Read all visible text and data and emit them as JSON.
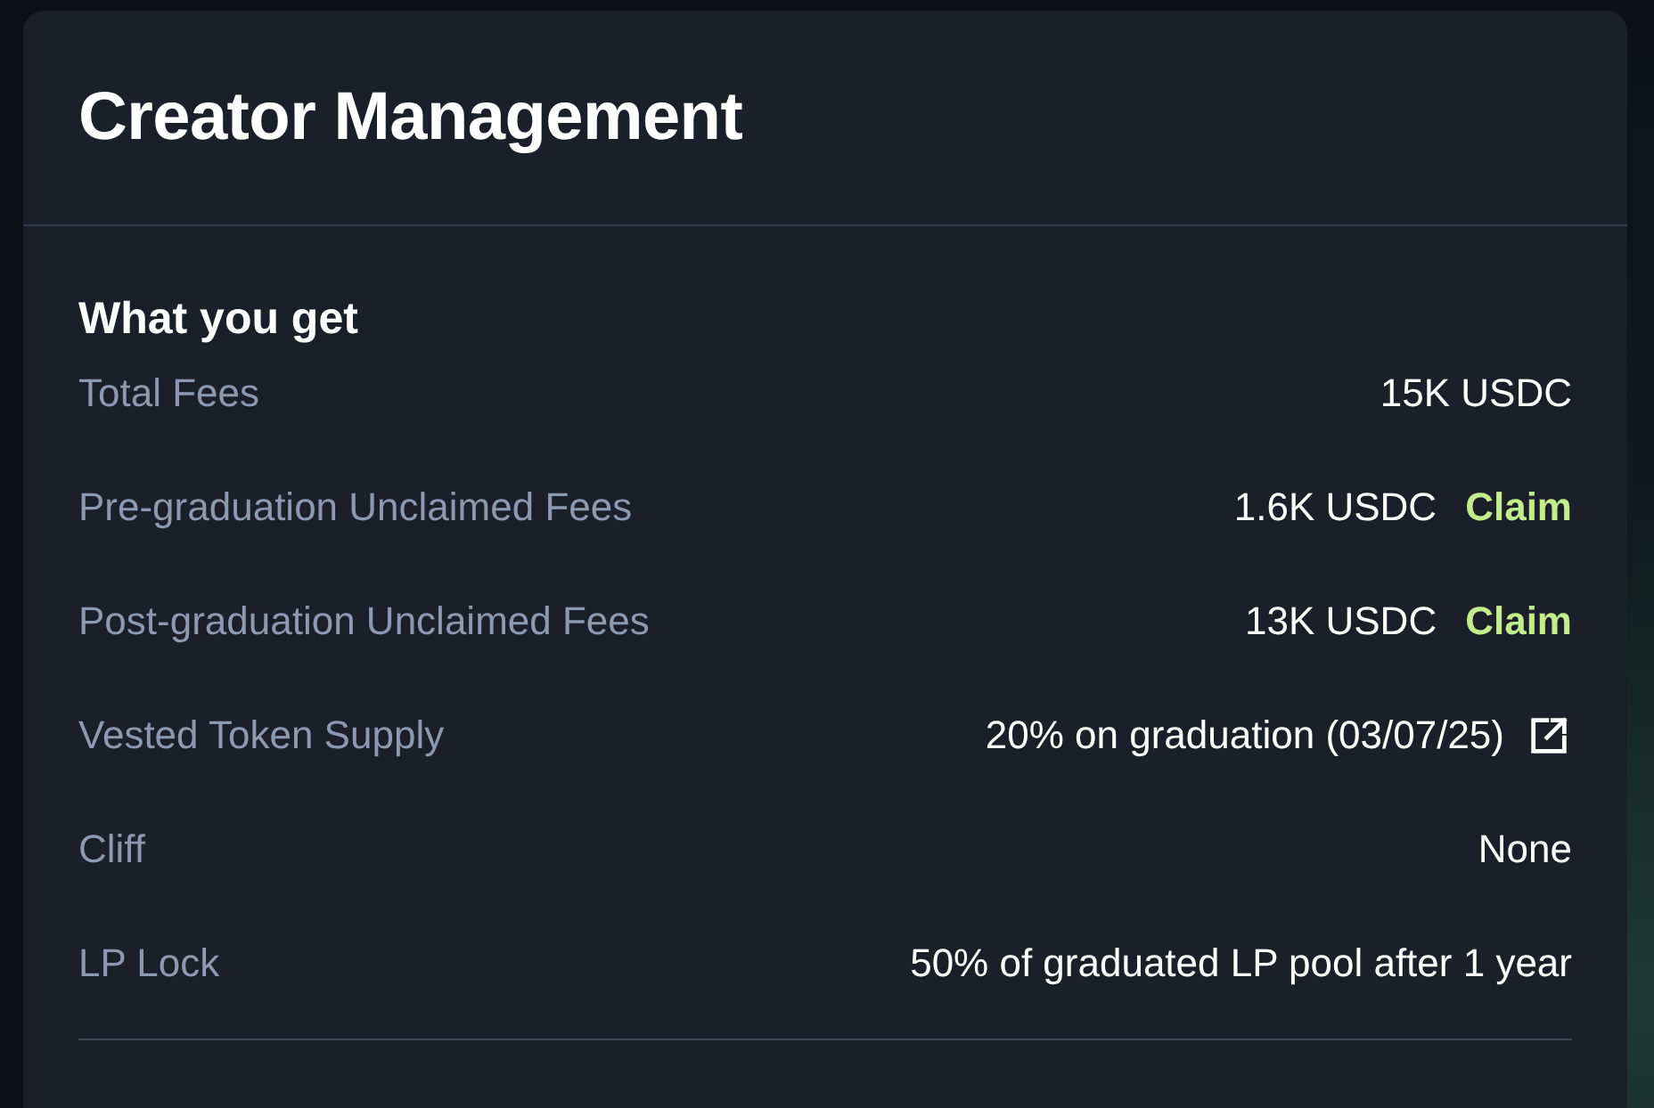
{
  "card": {
    "title": "Creator Management"
  },
  "section": {
    "heading": "What you get",
    "rows": [
      {
        "kind": "plain",
        "label": "Total Fees",
        "value": "15K USDC"
      },
      {
        "kind": "claim",
        "label": "Pre-graduation Unclaimed Fees",
        "value": "1.6K USDC",
        "action": "Claim"
      },
      {
        "kind": "claim",
        "label": "Post-graduation Unclaimed Fees",
        "value": "13K USDC",
        "action": "Claim"
      },
      {
        "kind": "link",
        "label": "Vested Token Supply",
        "value": "20% on graduation (03/07/25)"
      },
      {
        "kind": "plain",
        "label": "Cliff",
        "value": "None"
      },
      {
        "kind": "plain",
        "label": "LP Lock",
        "value": "50% of graduated LP pool after 1 year"
      }
    ]
  }
}
